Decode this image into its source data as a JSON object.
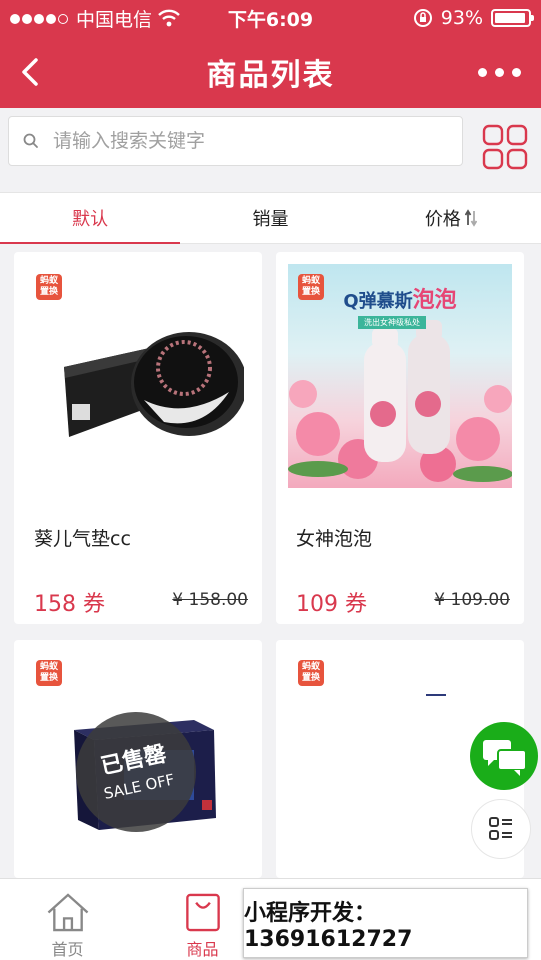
{
  "status": {
    "carrier": "中国电信",
    "time": "下午6:09",
    "battery": "93%",
    "battery_level": 0.93
  },
  "nav": {
    "title": "商品列表"
  },
  "search": {
    "placeholder": "请输入搜索关键字"
  },
  "tabs": [
    {
      "label": "默认",
      "active": true
    },
    {
      "label": "销量",
      "active": false
    },
    {
      "label": "价格",
      "active": false
    }
  ],
  "products": [
    {
      "badge": "蚂蚁置换",
      "name": "葵儿气垫cc",
      "price": "158 券",
      "old_price": "¥ 158.00"
    },
    {
      "badge": "蚂蚁置换",
      "name": "女神泡泡",
      "price": "109 券",
      "old_price": "¥ 109.00",
      "banner_title": "Q弹慕斯",
      "banner_hl": "泡泡",
      "banner_sub": "洗出女神级私处"
    },
    {
      "badge": "蚂蚁置换",
      "stamp_main": "已售罄",
      "stamp_sub": "SALE OFF"
    },
    {
      "badge": "蚂蚁置换"
    }
  ],
  "tabbar": [
    {
      "label": "首页",
      "icon": "home-icon",
      "active": false
    },
    {
      "label": "商品",
      "icon": "bag-icon",
      "active": true
    },
    {
      "label": "",
      "icon": "",
      "active": false
    },
    {
      "label": "",
      "icon": "",
      "active": false
    }
  ],
  "promo": {
    "text": "小程序开发：13691612727"
  },
  "colors": {
    "brand": "#d9384d",
    "chat": "#1aad19",
    "badge": "#e7543d"
  }
}
